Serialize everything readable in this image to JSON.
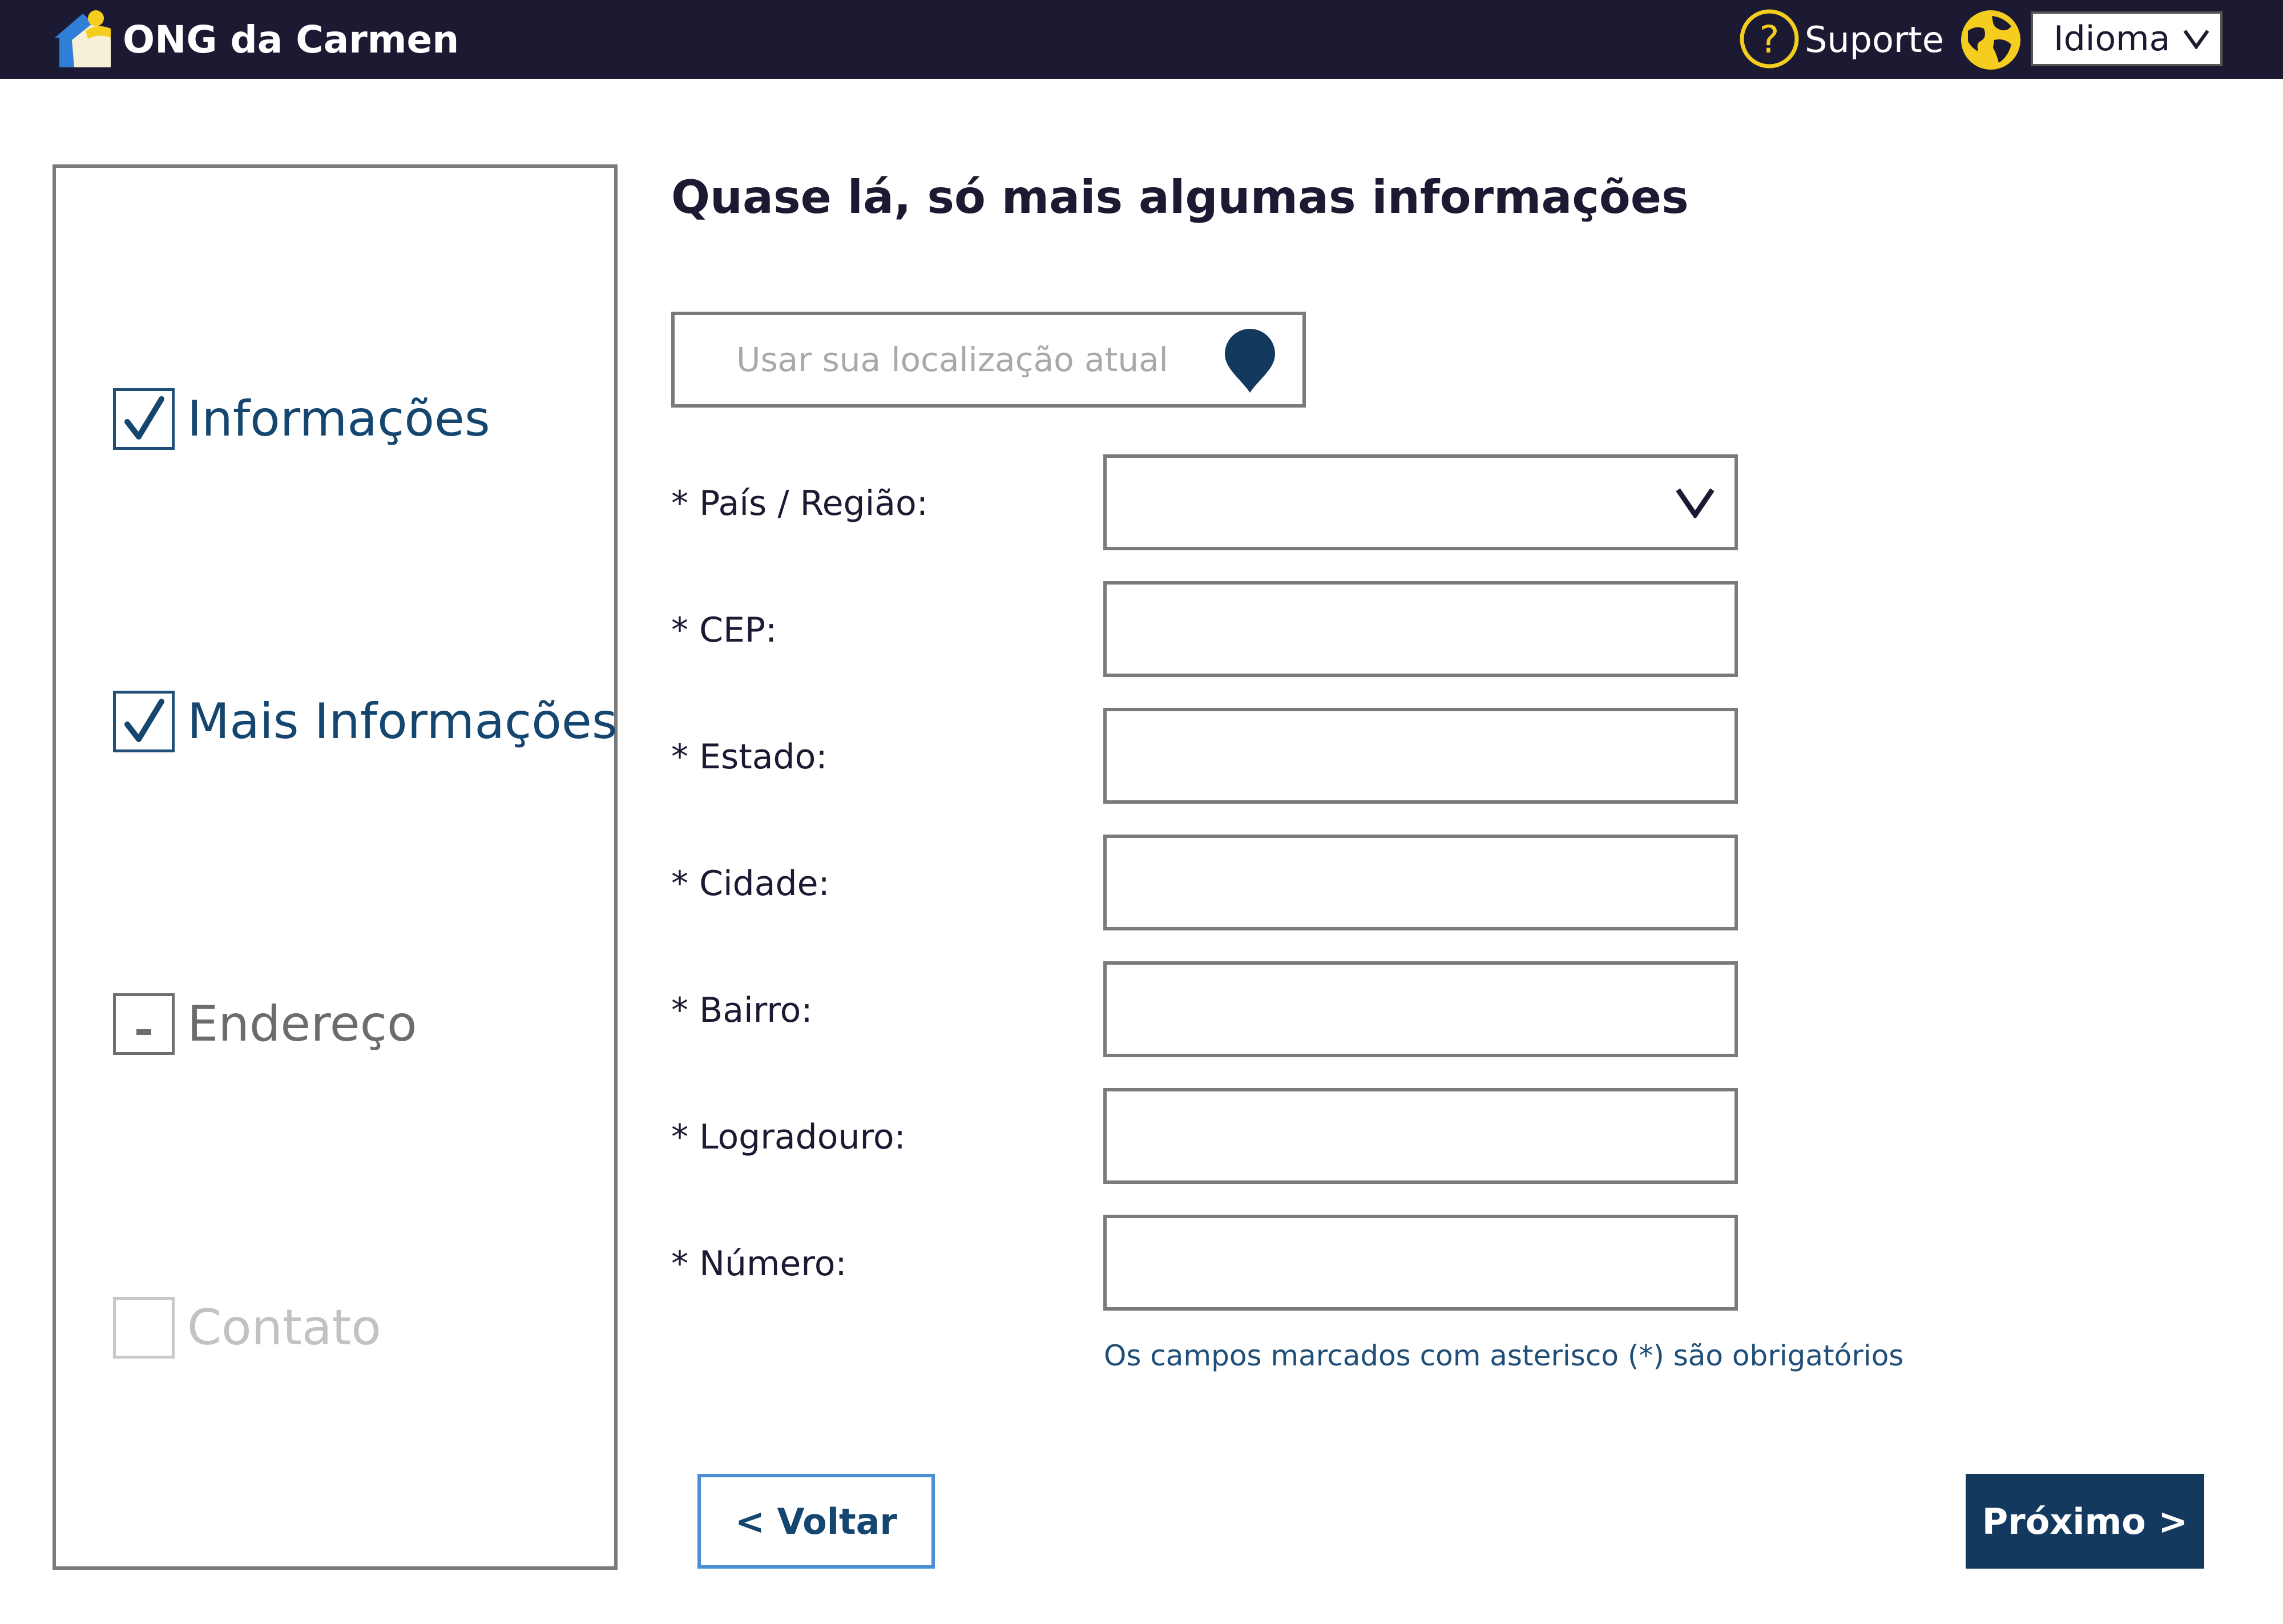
{
  "header": {
    "brand": "ONG da Carmen",
    "support_label": "Suporte",
    "language_label": "Idioma"
  },
  "stepper": {
    "steps": [
      {
        "label": "Informações",
        "state": "done"
      },
      {
        "label": "Mais Informações",
        "state": "done"
      },
      {
        "label": "Endereço",
        "state": "current"
      },
      {
        "label": "Contato",
        "state": "todo"
      }
    ]
  },
  "main": {
    "title": "Quase lá, só mais algumas informações",
    "location_placeholder": "Usar sua localização atual",
    "fields": [
      {
        "label": "* País / Região:",
        "value": ""
      },
      {
        "label": "* CEP:",
        "value": ""
      },
      {
        "label": "* Estado:",
        "value": ""
      },
      {
        "label": "* Cidade:",
        "value": ""
      },
      {
        "label": "* Bairro:",
        "value": ""
      },
      {
        "label": "* Logradouro:",
        "value": ""
      },
      {
        "label": "* Número:",
        "value": ""
      }
    ],
    "required_note": "Os campos marcados com asterisco (*) são obrigatórios"
  },
  "buttons": {
    "back": "< Voltar",
    "next": "Próximo >"
  },
  "colors": {
    "header_bg": "#1b1a32",
    "accent_yellow": "#f5cd1f",
    "primary_blue": "#14395f",
    "back_border": "#4a8fd6"
  },
  "icons": [
    "home-logo-icon",
    "help-circle-icon",
    "globe-icon",
    "chevron-down-icon",
    "check-icon",
    "dash-icon",
    "location-pin-icon"
  ]
}
